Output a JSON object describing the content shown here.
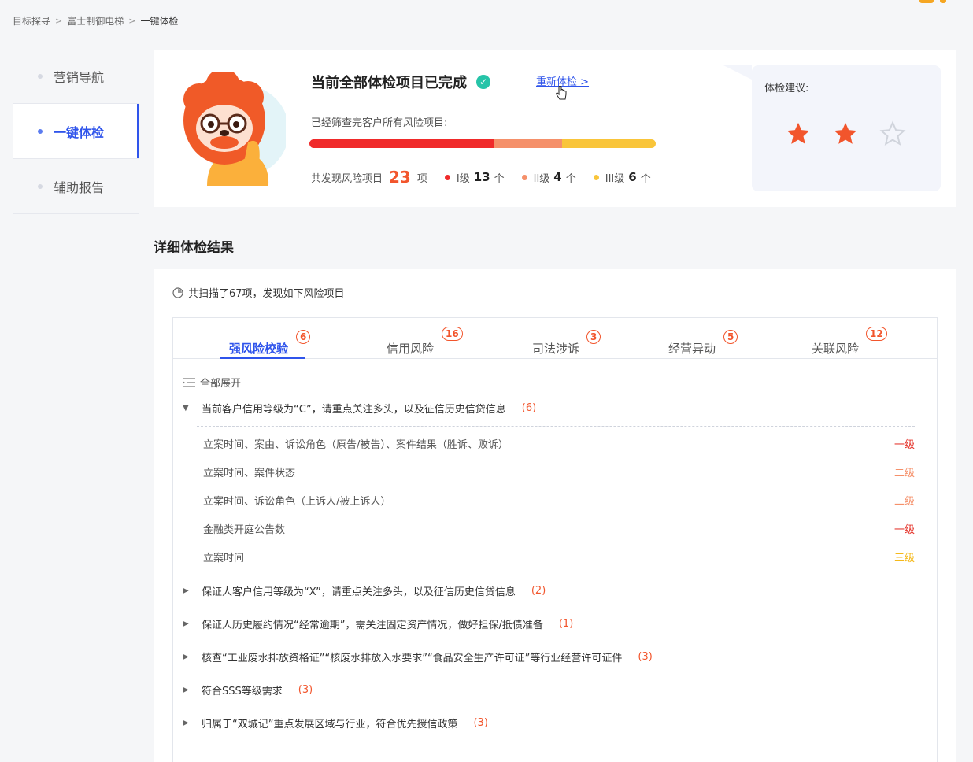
{
  "breadcrumb": [
    "目标探寻",
    "富士制御电梯",
    "一键体检"
  ],
  "sidebar": {
    "items": [
      {
        "label": "营销导航"
      },
      {
        "label": "一键体检"
      },
      {
        "label": "辅助报告"
      }
    ],
    "active_index": 1
  },
  "summary": {
    "title": "当前全部体检项目已完成",
    "recheck_link": "重新体检 >",
    "scan_text": "已经筛查完客户所有风险项目:",
    "total_prefix": "共发现风险项目",
    "total": "23",
    "total_unit": "项",
    "levels": [
      {
        "name": "I级",
        "count": "13",
        "unit": "个",
        "color": "#f02a2a"
      },
      {
        "name": "II级",
        "count": "4",
        "unit": "个",
        "color": "#f5906a"
      },
      {
        "name": "III级",
        "count": "6",
        "unit": "个",
        "color": "#f9c53a"
      }
    ]
  },
  "advice": {
    "title": "体检建议:",
    "rating": 2,
    "max_rating": 3
  },
  "detail": {
    "section_title": "详细体检结果",
    "scan_info": "共扫描了67项，发现如下风险项目",
    "tabs": [
      {
        "label": "强风险校验",
        "count": "6"
      },
      {
        "label": "信用风险",
        "count": "16"
      },
      {
        "label": "司法涉诉",
        "count": "3"
      },
      {
        "label": "经营异动",
        "count": "5"
      },
      {
        "label": "关联风险",
        "count": "12"
      }
    ],
    "expand_all": "全部展开",
    "groups": [
      {
        "title": "当前客户信用等级为“C”，请重点关注多头，以及征信历史信贷信息",
        "count": "(6)",
        "expanded": true
      },
      {
        "title": "保证人客户信用等级为“X”，请重点关注多头，以及征信历史信贷信息",
        "count": "(2)",
        "expanded": false
      },
      {
        "title": "保证人历史履约情况“经常逾期”，需关注固定资产情况，做好担保/抵债准备",
        "count": "(1)",
        "expanded": false
      },
      {
        "title": "核查“工业废水排放资格证”“核废水排放入水要求”“食品安全生产许可证”等行业经营许可证件",
        "count": "(3)",
        "expanded": false
      },
      {
        "title": "符合SSS等级需求",
        "count": "(3)",
        "expanded": false
      },
      {
        "title": "归属于“双城记”重点发展区域与行业，符合优先授信政策",
        "count": "(3)",
        "expanded": false
      }
    ],
    "items": [
      {
        "text": "立案时间、案由、诉讼角色（原告/被告）、案件结果（胜诉、败诉）",
        "level": "一级"
      },
      {
        "text": "立案时间、案件状态",
        "level": "二级"
      },
      {
        "text": "立案时间、诉讼角色（上诉人/被上诉人）",
        "level": "二级"
      },
      {
        "text": "金融类开庭公告数",
        "level": "一级"
      },
      {
        "text": "立案时间",
        "level": "三级"
      }
    ]
  }
}
